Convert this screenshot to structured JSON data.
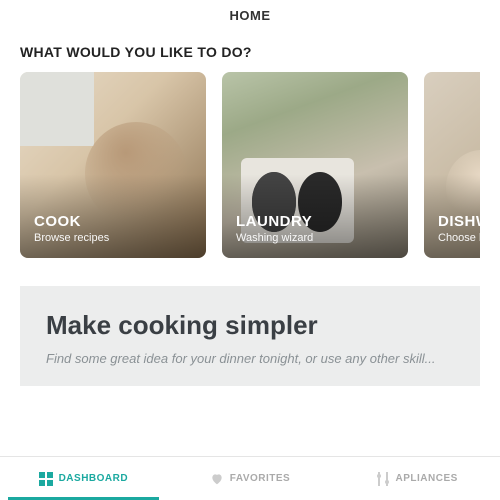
{
  "header": {
    "title": "HOME"
  },
  "prompt": "WHAT WOULD YOU LIKE TO DO?",
  "cards": [
    {
      "title": "COOK",
      "subtitle": "Browse recipes"
    },
    {
      "title": "LAUNDRY",
      "subtitle": "Washing wizard"
    },
    {
      "title": "DISHWASH",
      "subtitle": "Choose best prog"
    }
  ],
  "banner": {
    "title": "Make cooking simpler",
    "subtitle": "Find some great idea for your dinner tonight, or use any other skill..."
  },
  "tabs": [
    {
      "label": "DASHBOARD",
      "active": true
    },
    {
      "label": "FAVORITES",
      "active": false
    },
    {
      "label": "APLIANCES",
      "active": false
    }
  ],
  "colors": {
    "accent": "#1ba9a0"
  }
}
